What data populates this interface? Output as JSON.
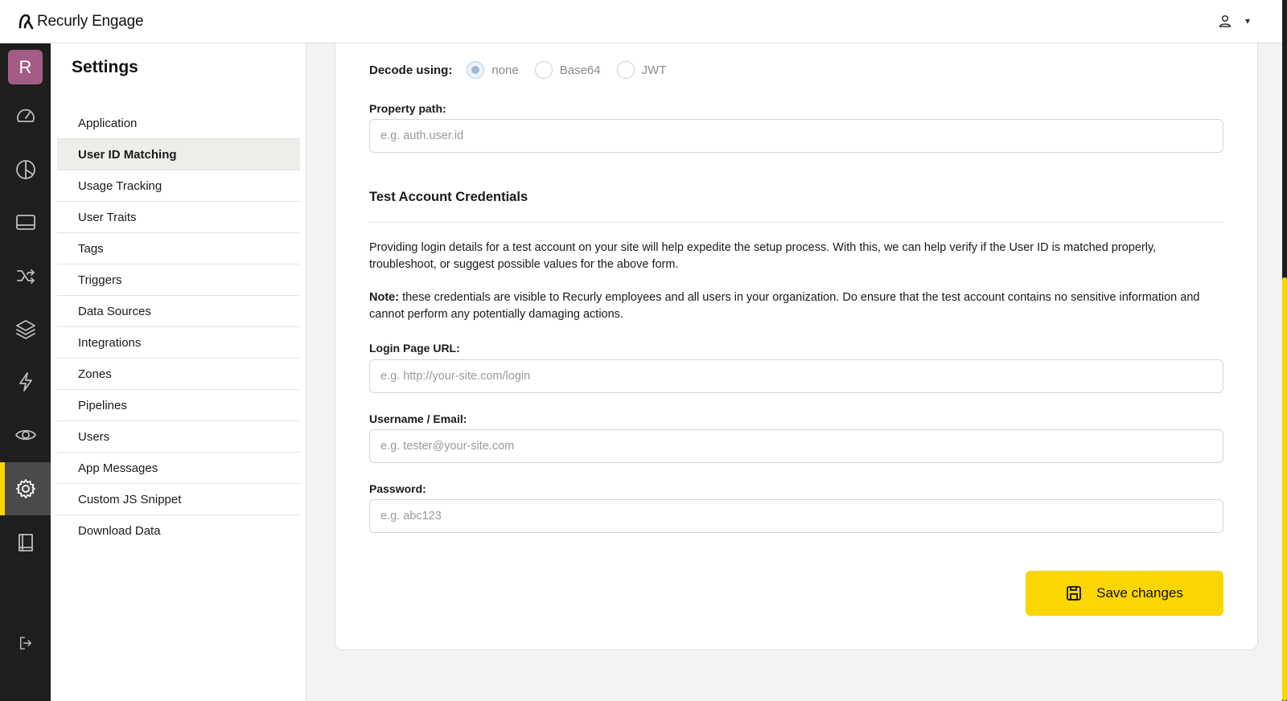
{
  "app": {
    "title": "Recurly Engage"
  },
  "header": {
    "user_icon": "user-icon",
    "caret": "▾"
  },
  "rail": {
    "avatar_letter": "R",
    "items": [
      {
        "icon": "speedometer-icon"
      },
      {
        "icon": "pie-chart-icon"
      },
      {
        "icon": "monitor-icon"
      },
      {
        "icon": "shuffle-icon"
      },
      {
        "icon": "layers-icon"
      },
      {
        "icon": "lightning-icon"
      },
      {
        "icon": "eye-icon"
      },
      {
        "icon": "gear-icon",
        "active": true
      },
      {
        "icon": "book-icon"
      },
      {
        "icon": "logout-icon"
      }
    ]
  },
  "subnav": {
    "title": "Settings",
    "items": [
      {
        "label": "Application"
      },
      {
        "label": "User ID Matching",
        "active": true
      },
      {
        "label": "Usage Tracking"
      },
      {
        "label": "User Traits"
      },
      {
        "label": "Tags"
      },
      {
        "label": "Triggers"
      },
      {
        "label": "Data Sources"
      },
      {
        "label": "Integrations"
      },
      {
        "label": "Zones"
      },
      {
        "label": "Pipelines"
      },
      {
        "label": "Users"
      },
      {
        "label": "App Messages"
      },
      {
        "label": "Custom JS Snippet"
      },
      {
        "label": "Download Data"
      }
    ]
  },
  "form": {
    "decode": {
      "label": "Decode using:",
      "options": [
        "none",
        "Base64",
        "JWT"
      ],
      "selected": "none"
    },
    "property_path": {
      "label": "Property path:",
      "placeholder": "e.g. auth.user.id"
    },
    "section_title": "Test Account Credentials",
    "intro": "Providing login details for a test account on your site will help expedite the setup process. With this, we can help verify if the User ID is matched properly, troubleshoot, or suggest possible values for the above form.",
    "note_label": "Note:",
    "note_text": " these credentials are visible to Recurly employees and all users in your organization. Do ensure that the test account contains no sensitive information and cannot perform any potentially damaging actions.",
    "login_url": {
      "label": "Login Page URL:",
      "placeholder": "e.g. http://your-site.com/login"
    },
    "username": {
      "label": "Username / Email:",
      "placeholder": "e.g. tester@your-site.com"
    },
    "password": {
      "label": "Password:",
      "placeholder": "e.g. abc123"
    },
    "save_label": "Save changes"
  },
  "colors": {
    "accent": "#fcd600",
    "avatar": "#a45c87",
    "rail": "#1e1e1e"
  }
}
